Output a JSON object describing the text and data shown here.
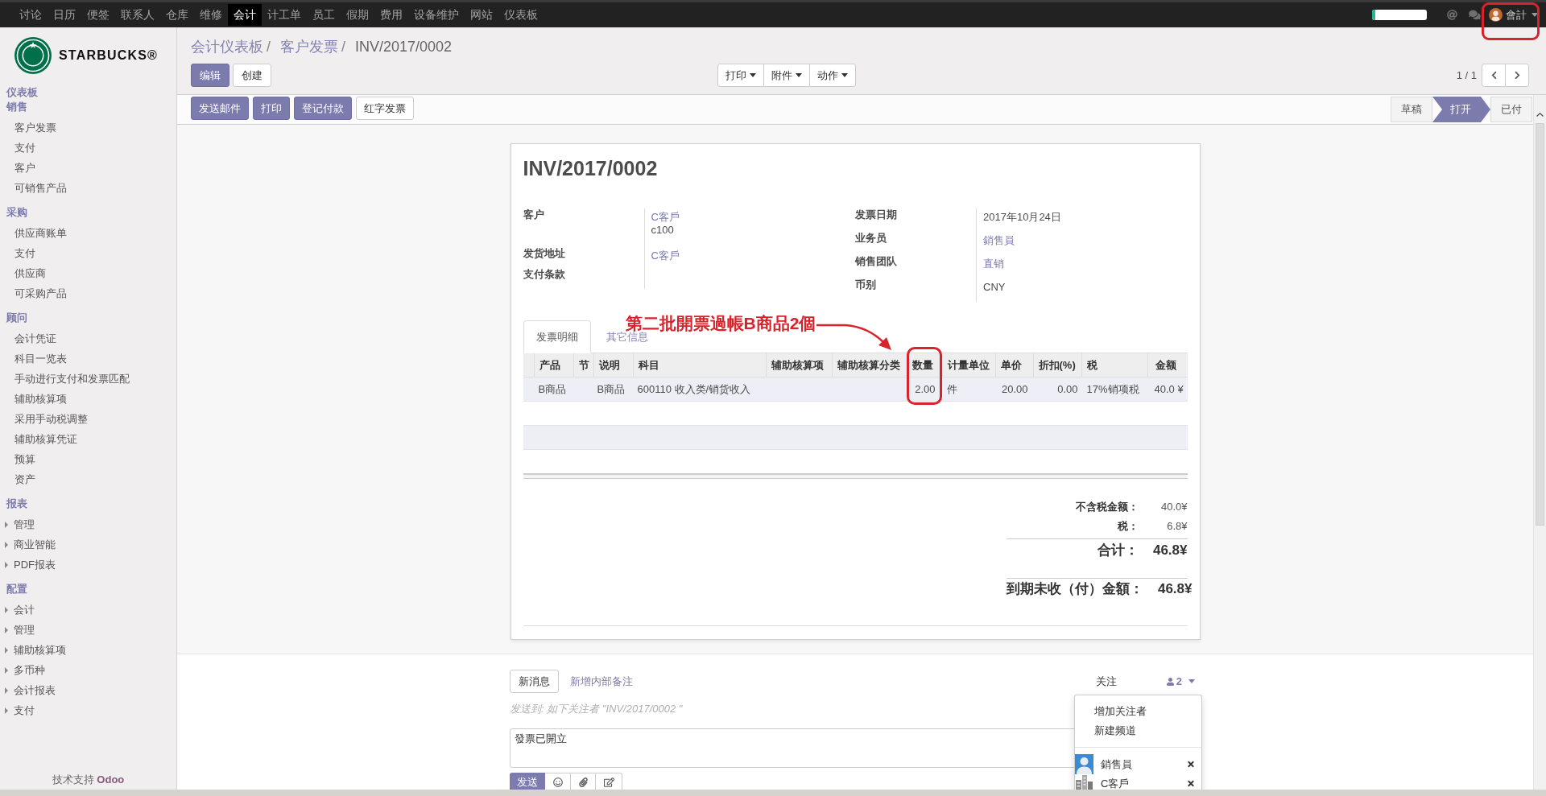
{
  "top_menu": [
    {
      "label": "讨论",
      "selected": false
    },
    {
      "label": "日历",
      "selected": false
    },
    {
      "label": "便签",
      "selected": false
    },
    {
      "label": "联系人",
      "selected": false
    },
    {
      "label": "仓库",
      "selected": false
    },
    {
      "label": "维修",
      "selected": false
    },
    {
      "label": "会计",
      "selected": true
    },
    {
      "label": "计工单",
      "selected": false
    },
    {
      "label": "员工",
      "selected": false
    },
    {
      "label": "假期",
      "selected": false
    },
    {
      "label": "费用",
      "selected": false
    },
    {
      "label": "设备维护",
      "selected": false
    },
    {
      "label": "网站",
      "selected": false
    },
    {
      "label": "仪表板",
      "selected": false
    }
  ],
  "top_right": {
    "progress": {
      "level": 0.06
    },
    "user": {
      "name": "會計"
    }
  },
  "sidebar": {
    "brand": "STARBUCKS®",
    "sections": [
      {
        "heading": "仪表板"
      },
      {
        "heading": "销售",
        "items": [
          {
            "label": "客户发票",
            "kind": "link"
          },
          {
            "label": "支付",
            "kind": "link"
          },
          {
            "label": "客户",
            "kind": "link"
          },
          {
            "label": "可销售产品",
            "kind": "link"
          }
        ]
      },
      {
        "heading": "采购",
        "items": [
          {
            "label": "供应商账单",
            "kind": "link"
          },
          {
            "label": "支付",
            "kind": "link"
          },
          {
            "label": "供应商",
            "kind": "link"
          },
          {
            "label": "可采购产品",
            "kind": "link"
          }
        ]
      },
      {
        "heading": "顾问",
        "items": [
          {
            "label": "会计凭证",
            "kind": "link"
          },
          {
            "label": "科目一览表",
            "kind": "link"
          },
          {
            "label": "手动进行支付和发票匹配",
            "kind": "link"
          },
          {
            "label": "辅助核算项",
            "kind": "link"
          },
          {
            "label": "采用手动税调整",
            "kind": "link"
          },
          {
            "label": "辅助核算凭证",
            "kind": "link"
          },
          {
            "label": "预算",
            "kind": "link"
          },
          {
            "label": "资产",
            "kind": "link"
          }
        ]
      },
      {
        "heading": "报表",
        "items": [
          {
            "label": "管理",
            "kind": "submenu"
          },
          {
            "label": "商业智能",
            "kind": "submenu"
          },
          {
            "label": "PDF报表",
            "kind": "submenu"
          }
        ]
      },
      {
        "heading": "配置",
        "items": [
          {
            "label": "会计",
            "kind": "submenu"
          },
          {
            "label": "管理",
            "kind": "submenu"
          },
          {
            "label": "辅助核算项",
            "kind": "submenu"
          },
          {
            "label": "多币种",
            "kind": "submenu"
          },
          {
            "label": "会计报表",
            "kind": "submenu"
          },
          {
            "label": "支付",
            "kind": "submenu"
          }
        ]
      }
    ],
    "footer": {
      "text": "技术支持",
      "link": "Odoo"
    }
  },
  "breadcrumb": {
    "separator": "/",
    "items": [
      {
        "label": "会计仪表板",
        "kind": "link"
      },
      {
        "label": "客户发票",
        "kind": "link"
      },
      {
        "label": "INV/2017/0002",
        "kind": "current"
      }
    ]
  },
  "control_buttons": [
    {
      "label": "编辑",
      "kind": "primary"
    },
    {
      "label": "创建",
      "kind": "secondary"
    }
  ],
  "control_menus": [
    {
      "label": "打印"
    },
    {
      "label": "附件"
    },
    {
      "label": "动作"
    }
  ],
  "pager": {
    "counter": "1 / 1"
  },
  "action_buttons": [
    {
      "label": "发送邮件",
      "kind": "primary"
    },
    {
      "label": "打印",
      "kind": "primary"
    },
    {
      "label": "登记付款",
      "kind": "primary"
    },
    {
      "label": "红字发票",
      "kind": "secondary"
    }
  ],
  "statuses": [
    {
      "label": "草稿",
      "selected": false
    },
    {
      "label": "打开",
      "selected": true
    },
    {
      "label": "已付",
      "selected": false
    }
  ],
  "invoice": {
    "title": "INV/2017/0002",
    "left_fields": [
      {
        "label": "客户",
        "values": [
          {
            "text": "C客戶",
            "kind": "link"
          },
          {
            "text": "c100",
            "kind": "plain"
          }
        ]
      },
      {
        "label": "发货地址",
        "values": [
          {
            "text": "C客戶",
            "kind": "link"
          }
        ]
      },
      {
        "label": "支付条款"
      }
    ],
    "right_fields": [
      {
        "label": "发票日期",
        "values": [
          {
            "text": "2017年10月24日",
            "kind": "plain"
          }
        ]
      },
      {
        "label": "业务员",
        "values": [
          {
            "text": "銷售員",
            "kind": "link"
          }
        ]
      },
      {
        "label": "销售团队",
        "values": [
          {
            "text": "直销",
            "kind": "link"
          }
        ]
      },
      {
        "label": "币别",
        "values": [
          {
            "text": "CNY",
            "kind": "plain"
          }
        ]
      }
    ],
    "tabs": [
      {
        "label": "发票明细",
        "selected": true
      },
      {
        "label": "其它信息",
        "selected": false
      }
    ],
    "annotation": {
      "text": "第二批開票過帳B商品2個"
    },
    "table": {
      "columns": [
        "产品",
        "节",
        "说明",
        "科目",
        "辅助核算项",
        "辅助核算分类",
        "数量",
        "计量单位",
        "单价",
        "折扣(%)",
        "税",
        "金额"
      ],
      "rows": [
        {
          "cells": [
            "B商品",
            null,
            "B商品",
            "600110 收入类/销货收入",
            null,
            null,
            "2.00",
            "件",
            "20.00",
            "0.00",
            "17%销项税",
            "40.0 ¥"
          ]
        }
      ]
    },
    "totals": [
      {
        "label": "不含税金额：",
        "value": "40.0¥",
        "kind": "plain"
      },
      {
        "label": "税：",
        "value": "6.8¥",
        "kind": "plain"
      },
      {
        "label": "合计：",
        "value": "46.8¥",
        "kind": "total"
      },
      {
        "label": "到期未收（付）金額：",
        "value": "46.8¥",
        "kind": "due"
      }
    ]
  },
  "chatter": {
    "buttons": [
      {
        "label": "新消息",
        "kind": "button"
      },
      {
        "label": "新增内部备注",
        "kind": "link"
      }
    ],
    "follow_label": "关注",
    "followers_count": "2",
    "recipients_hint": "发送到: 如下关注者 \"INV/2017/0002 \"",
    "message": "發票已開立",
    "send_label": "发送",
    "menu": {
      "actions": [
        "增加关注者",
        "新建频道"
      ],
      "followers": [
        {
          "name": "銷售員",
          "kind": "user"
        },
        {
          "name": "C客戶",
          "kind": "company"
        }
      ]
    }
  }
}
